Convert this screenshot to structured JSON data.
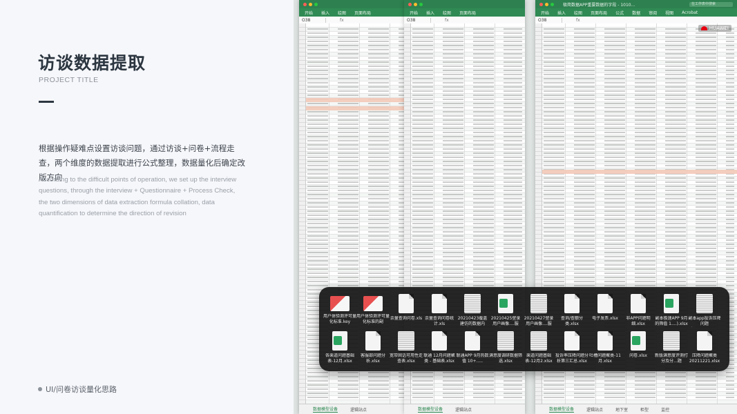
{
  "page": {
    "title": "访谈数据提取",
    "subtitle": "PROJECT TITLE",
    "description_cn": "根据操作疑难点设置访谈问题，通过访谈+问卷+流程走查，两个维度的数据提取进行公式整理，数据量化后确定改版方向",
    "description_en": "According to the difficult points of operation, we set up the interview questions, through the interview + Questionnaire + Process Check, the two dimensions of data extraction formula collation, data quantification to determine the direction of revision",
    "footer": "UI/问卷访谈量化思路"
  },
  "spreadsheet": {
    "window_title": "极简数据APP重要数据的字段 - 1010...",
    "search_placeholder": "在工作表中搜索",
    "cell_ref": "O38",
    "fx": "fx",
    "ribbon": [
      "开始",
      "插入",
      "绘图",
      "页面布局",
      "公式",
      "数据",
      "审阅",
      "视图",
      "Acrobat"
    ],
    "sheet_tabs": [
      "数据模型设备",
      "逻辑站点",
      "地下室",
      "柜型",
      "监控"
    ],
    "watermark": "HUAWEI"
  },
  "finder": {
    "files": [
      {
        "name": "用户体验测评可量化标准.key",
        "icon": "key"
      },
      {
        "name": "用户体验测评可量化标准的副本.key",
        "icon": "key"
      },
      {
        "name": "余量查询问卷.xls",
        "icon": "doc"
      },
      {
        "name": "余量查询问卷统计.xls",
        "icon": "doc"
      },
      {
        "name": "20210423覆盖建仿的数据内容.xlsx",
        "icon": "thumb"
      },
      {
        "name": "20210425登录用户画像....服部.xlsx",
        "icon": "xls"
      },
      {
        "name": "20210427登录用户画像....服部.xlsx",
        "icon": "thumb"
      },
      {
        "name": "查询/查额分类.xlsx",
        "icon": "doc"
      },
      {
        "name": "电子发票.xlsx",
        "icon": "doc"
      },
      {
        "name": "非APP问题明细.xlsx",
        "icon": "doc"
      },
      {
        "name": "副本极速APP 9月的筛值 1....).xlsx",
        "icon": "xls"
      },
      {
        "name": "副本app投诉压降问题解....216.xlsx",
        "icon": "thumb"
      },
      {
        "name": "各渠道问题基础表-12月.xlsx",
        "icon": "xls"
      },
      {
        "name": "客服部问题分析.xlsx",
        "icon": "doc"
      },
      {
        "name": "宽带固话可用性走查表.xlsx",
        "icon": "thumb"
      },
      {
        "name": "联通 12月问题聚类 - 基础表.xlsx",
        "icon": "doc"
      },
      {
        "name": "联通APP 9月热数值 10+.....服).xlsx",
        "icon": "doc"
      },
      {
        "name": "满意度调研数据筛选.xlsx",
        "icon": "thumb"
      },
      {
        "name": "渠道问题基础表-12月2.xlsx",
        "icon": "thumb"
      },
      {
        "name": "投诉率压降问题分析第三汇总.xlsx",
        "icon": "doc"
      },
      {
        "name": "吐槽问题聚类-11月.xlsx",
        "icon": "doc"
      },
      {
        "name": "问卷.xlsx",
        "icon": "xls"
      },
      {
        "name": "新版满意度评测打分及分...题(1).xlsx",
        "icon": "thumb"
      },
      {
        "name": "压降问题聚类20211221.xlsx",
        "icon": "doc"
      }
    ]
  },
  "colors": {
    "accent": "#2f8a53",
    "title": "#2c3640"
  }
}
